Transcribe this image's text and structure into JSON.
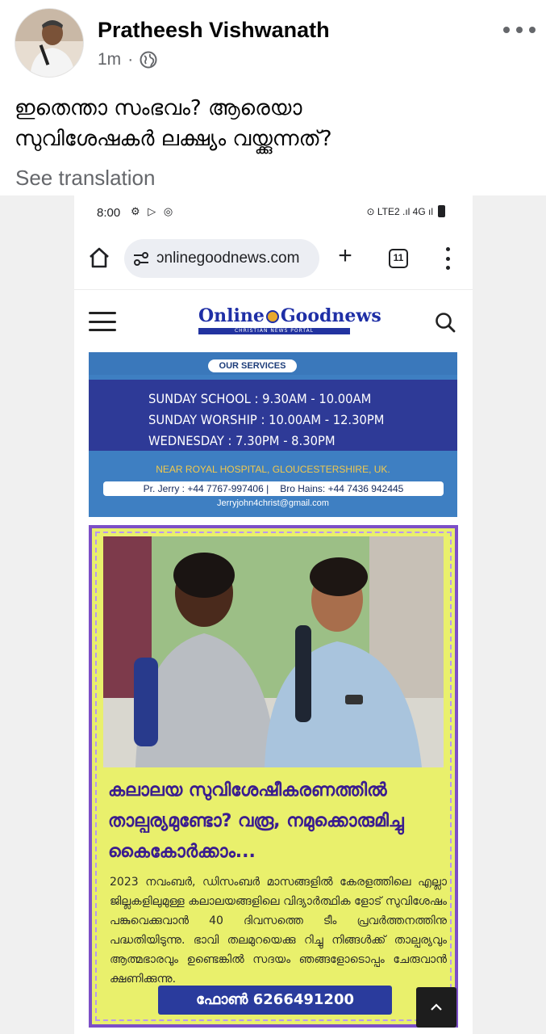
{
  "post": {
    "author": "Pratheesh Vishwanath",
    "time": "1m",
    "separator": "·",
    "text_line1": "ഇതെന്താ സംഭവം? ആരെയാ",
    "text_line2": "സുവിശേഷകർ ലക്ഷ്യം വയ്ക്കുന്നത്?",
    "see_translation": "See translation"
  },
  "screenshot": {
    "status": {
      "time": "8:00",
      "left_icons": "⚙ ▷ ◎",
      "right_icons": "⊙ LTE2 .ıl 4G ıl"
    },
    "browser": {
      "url": "ɔnlinegoodnews.com",
      "new_tab": "+",
      "tab_count": "11"
    },
    "site": {
      "logo_online": "Online",
      "logo_goodnews": "Goodnews",
      "logo_tagline": "CHRISTIAN NEWS PORTAL"
    },
    "services": {
      "tag": "OUR SERVICES",
      "line1": "SUNDAY SCHOOL : 9.30AM - 10.00AM",
      "line2": "SUNDAY WORSHIP : 10.00AM - 12.30PM",
      "line3": "WEDNESDAY : 7.30PM - 8.30PM",
      "address": "NEAR ROYAL HOSPITAL, GLOUCESTERSHIRE, UK.",
      "contact1": "Pr. Jerry :  +44 7767-997406 |",
      "contact2": "Bro Hains:  +44 7436 942445",
      "email": "Jerryjohn4christ@gmail.com"
    },
    "advert": {
      "heading": "കലാലയ സുവിശേഷീകരണത്തിൽ താല്പര്യമുണ്ടോ? വരൂ, നമുക്കൊരുമിച്ചു കൈകോർക്കാം...",
      "body": "2023 നവംബർ, ഡിസംബർ മാസങ്ങളിൽ കേരളത്തിലെ എല്ലാ ജില്ലകളിലുമുള്ള കലാലയങ്ങളിലെ വിദ്യാർത്ഥിക ളോട് സുവിശേഷം പങ്കുവെക്കുവാൻ 40 ദിവസത്തെ ടീം പ്രവർത്തനത്തിനു പദ്ധതിയിടുന്നു. ഭാവി തലമുറയെക്കു റിച്ചു നിങ്ങൾക്ക് താല്പര്യവും ആത്മഭാരവും ഉണ്ടെങ്കിൽ സദയം ഞങ്ങളോടൊപ്പം ചേരുവാൻ ക്ഷണിക്കുന്നു.",
      "phone": "ഫോൺ 6266491200"
    }
  },
  "icons": {
    "more": "more-horizontal-icon",
    "globe": "globe-icon",
    "home": "home-icon",
    "tune": "site-info-icon",
    "menu": "hamburger-menu-icon",
    "search": "search-icon",
    "scroll_top": "chevron-up-icon"
  }
}
